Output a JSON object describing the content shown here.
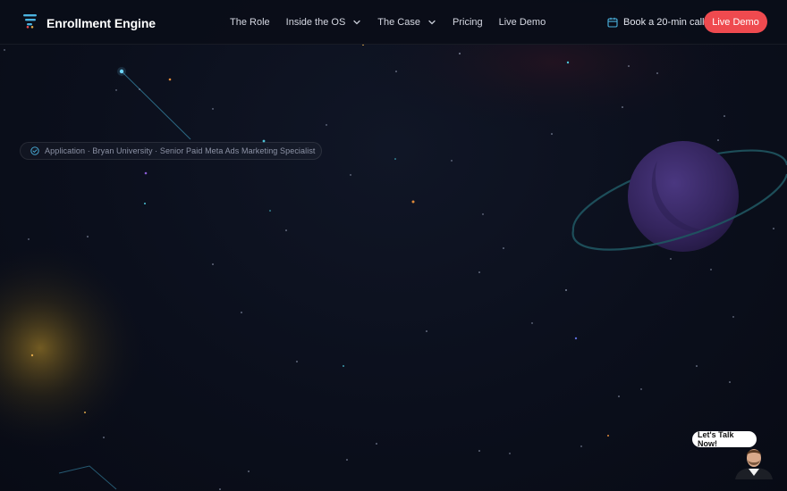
{
  "brand": {
    "name": "Enrollment Engine",
    "logo_icon": "stacked-bars-logo"
  },
  "nav": {
    "items": [
      {
        "label": "The Role",
        "has_dropdown": false
      },
      {
        "label": "Inside the OS",
        "has_dropdown": true
      },
      {
        "label": "The Case",
        "has_dropdown": true
      },
      {
        "label": "Pricing",
        "has_dropdown": false
      },
      {
        "label": "Live Demo",
        "has_dropdown": false
      }
    ]
  },
  "header": {
    "book_call_label": "Book a 20-min call",
    "book_call_icon": "calendar-icon",
    "cta_label": "Live Demo",
    "cta_color": "#ef4a4f"
  },
  "hero": {
    "badge_text": "Application · Bryan University · Senior Paid Meta Ads Marketing Specialist",
    "badge_icon": "check-circle-icon"
  },
  "chat": {
    "bubble_label": "Let's Talk Now!",
    "avatar": "person-avatar"
  },
  "colors": {
    "background": "#0b0f1c",
    "accent_red": "#ef4a4f",
    "planet": "#3b2a66",
    "ring": "#1f5560"
  }
}
